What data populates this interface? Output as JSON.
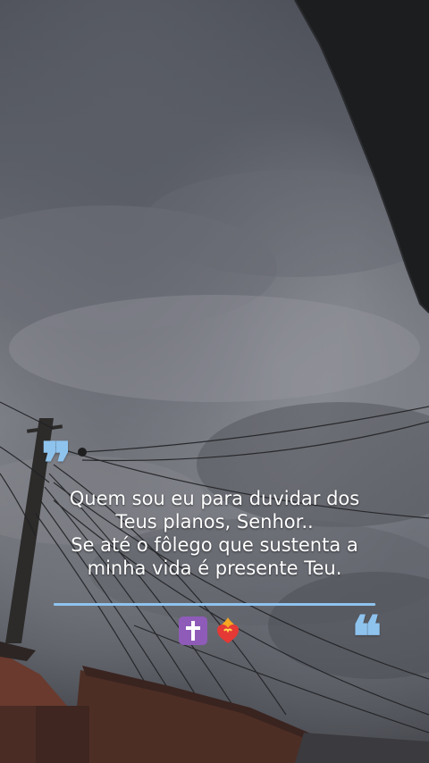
{
  "quote": {
    "lines": [
      "Quem sou eu para duvidar dos",
      "Teus planos, Senhor..",
      "Se até o fôlego que sustenta a",
      "minha vida é presente Teu."
    ],
    "open_mark": "❞",
    "close_mark": "❝"
  },
  "emojis": [
    "latin-cross-icon",
    "burning-heart-icon"
  ],
  "colors": {
    "accent": "#8ec3ee",
    "text": "#ffffff"
  }
}
